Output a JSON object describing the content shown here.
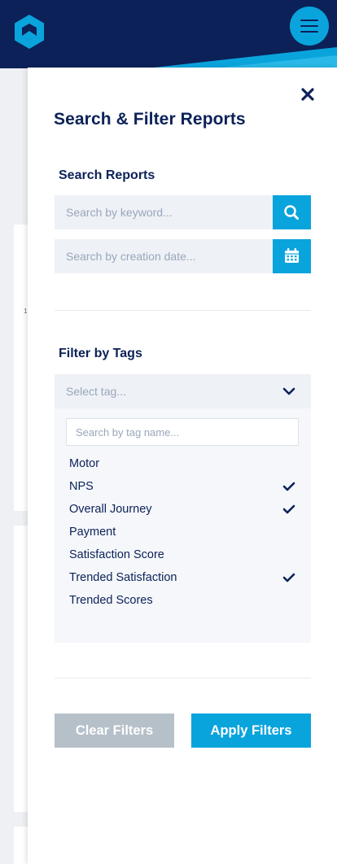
{
  "header": {
    "brand_color": "#0b2158",
    "accent_color": "#0aa4dd",
    "logo_icon": "hexagon-logo-icon",
    "menu_icon": "hamburger-menu-icon"
  },
  "background": {
    "fragment_text": "1"
  },
  "panel": {
    "title": "Search & Filter Reports",
    "close_icon": "close-icon",
    "search": {
      "heading": "Search Reports",
      "keyword_placeholder": "Search by keyword...",
      "keyword_icon": "search-icon",
      "date_placeholder": "Search by creation date...",
      "date_icon": "calendar-icon"
    },
    "tags": {
      "heading": "Filter by Tags",
      "select_placeholder": "Select tag...",
      "select_icon": "chevron-down-icon",
      "search_placeholder": "Search by tag name...",
      "items": [
        {
          "label": "Motor",
          "checked": false
        },
        {
          "label": "NPS",
          "checked": true
        },
        {
          "label": "Overall Journey",
          "checked": true
        },
        {
          "label": "Payment",
          "checked": false
        },
        {
          "label": "Satisfaction Score",
          "checked": false
        },
        {
          "label": "Trended Satisfaction",
          "checked": true
        },
        {
          "label": "Trended Scores",
          "checked": false
        }
      ]
    },
    "actions": {
      "clear_label": "Clear Filters",
      "apply_label": "Apply Filters"
    }
  }
}
